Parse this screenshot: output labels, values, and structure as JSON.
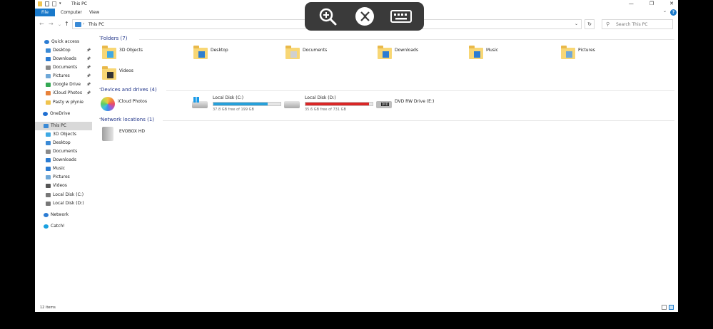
{
  "window": {
    "title": "This PC",
    "controls": {
      "minimize": "—",
      "maximize": "❐",
      "close": "✕"
    }
  },
  "ribbon": {
    "tabs": [
      "File",
      "Computer",
      "View"
    ],
    "help": "?"
  },
  "address": {
    "path": "This PC",
    "search_placeholder": "Search This PC"
  },
  "sidebar": {
    "items": [
      {
        "label": "Quick access",
        "icon": "star-icon",
        "color": "#2b7cd3",
        "pinned": false
      },
      {
        "label": "Desktop",
        "icon": "desktop-icon",
        "color": "#3a8ad6",
        "pinned": true
      },
      {
        "label": "Downloads",
        "icon": "download-icon",
        "color": "#2b7cd3",
        "pinned": true
      },
      {
        "label": "Documents",
        "icon": "documents-icon",
        "color": "#8a8a8a",
        "pinned": true
      },
      {
        "label": "Pictures",
        "icon": "pictures-icon",
        "color": "#6fa8d8",
        "pinned": true
      },
      {
        "label": "Google Drive",
        "icon": "google-drive-icon",
        "color": "#34a853",
        "pinned": true
      },
      {
        "label": "iCloud Photos",
        "icon": "icloud-photos-icon",
        "color": "#e8823a",
        "pinned": true
      },
      {
        "label": "Pasty w płynie",
        "icon": "folder-icon",
        "color": "#f0c44e",
        "pinned": false
      },
      {
        "label": "OneDrive",
        "icon": "cloud-icon",
        "color": "#1f6fd1",
        "pinned": false
      },
      {
        "label": "This PC",
        "icon": "computer-icon",
        "color": "#3a8ad6",
        "pinned": false
      },
      {
        "label": "3D Objects",
        "icon": "cube-icon",
        "color": "#3fa9e4",
        "pinned": false
      },
      {
        "label": "Desktop",
        "icon": "desktop-icon",
        "color": "#3a8ad6",
        "pinned": false
      },
      {
        "label": "Documents",
        "icon": "documents-icon",
        "color": "#8a8a8a",
        "pinned": false
      },
      {
        "label": "Downloads",
        "icon": "download-icon",
        "color": "#2b7cd3",
        "pinned": false
      },
      {
        "label": "Music",
        "icon": "music-icon",
        "color": "#2b7cd3",
        "pinned": false
      },
      {
        "label": "Pictures",
        "icon": "pictures-icon",
        "color": "#6fa8d8",
        "pinned": false
      },
      {
        "label": "Videos",
        "icon": "videos-icon",
        "color": "#555555",
        "pinned": false
      },
      {
        "label": "Local Disk (C:)",
        "icon": "drive-icon",
        "color": "#777777",
        "pinned": false
      },
      {
        "label": "Local Disk (D:)",
        "icon": "drive-icon",
        "color": "#777777",
        "pinned": false
      },
      {
        "label": "Network",
        "icon": "network-icon",
        "color": "#2b7cd3",
        "pinned": false
      },
      {
        "label": "Catch!",
        "icon": "catch-icon",
        "color": "#1aa0e0",
        "pinned": false
      }
    ]
  },
  "groups": {
    "folders": {
      "heading": "Folders (7)",
      "items": [
        {
          "label": "3D Objects",
          "icon": "cube-icon",
          "color": "#3fa9e4"
        },
        {
          "label": "Desktop",
          "icon": "desktop-icon",
          "color": "#2f7fd0"
        },
        {
          "label": "Documents",
          "icon": "documents-icon",
          "color": "#d0d0d0"
        },
        {
          "label": "Downloads",
          "icon": "download-icon",
          "color": "#2b7cd3"
        },
        {
          "label": "Music",
          "icon": "music-icon",
          "color": "#2b7cd3"
        },
        {
          "label": "Pictures",
          "icon": "pictures-icon",
          "color": "#6fa8d8"
        },
        {
          "label": "Videos",
          "icon": "videos-icon",
          "color": "#333333"
        }
      ]
    },
    "devices": {
      "heading": "Devices and drives (4)",
      "items": [
        {
          "label": "iCloud Photos",
          "icon": "icloud-photos-icon",
          "type": "app"
        },
        {
          "label": "Local Disk (C:)",
          "icon": "windows-drive-icon",
          "type": "drive",
          "free_text": "37.8 GB free of 199 GB",
          "used_fraction": 0.81,
          "bar_color": "#26a0da"
        },
        {
          "label": "Local Disk (D:)",
          "icon": "drive-icon",
          "type": "drive",
          "free_text": "35.6 GB free of 731 GB",
          "used_fraction": 0.95,
          "bar_color": "#da2626"
        },
        {
          "label": "DVD RW Drive (E:)",
          "icon": "dvd-drive-icon",
          "type": "dvd"
        }
      ]
    },
    "network": {
      "heading": "Network locations (1)",
      "items": [
        {
          "label": "EVOBOX HD",
          "icon": "network-drive-icon"
        }
      ]
    }
  },
  "status": {
    "item_count": "12 items"
  },
  "remote_toolbar": {
    "buttons": [
      "zoom-in-icon",
      "remote-connection-icon",
      "keyboard-icon"
    ]
  }
}
